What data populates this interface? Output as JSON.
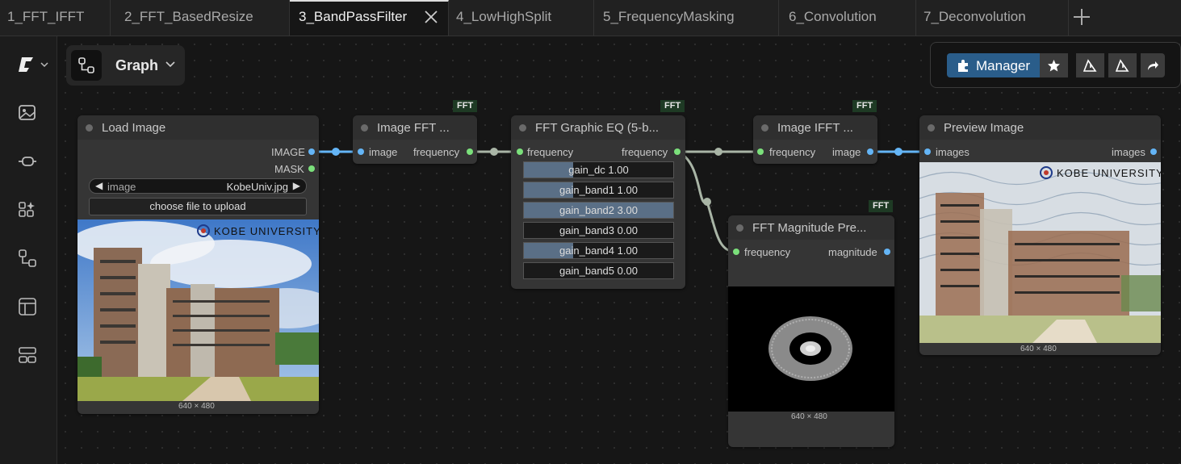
{
  "tabs": [
    {
      "label": "1_FFT_IFFT"
    },
    {
      "label": "2_FFT_BasedResize"
    },
    {
      "label": "3_BandPassFilter",
      "active": true
    },
    {
      "label": "4_LowHighSplit"
    },
    {
      "label": "5_FrequencyMasking"
    },
    {
      "label": "6_Convolution"
    },
    {
      "label": "7_Deconvolution"
    }
  ],
  "icons": {
    "logo": "comfy-logo-icon",
    "images": "images-icon",
    "nodes": "node-library-icon",
    "models": "model-library-icon",
    "workflows": "workflows-icon",
    "templates": "templates-icon",
    "queue": "queue-icon",
    "manager": "puzzle-icon",
    "star": "star-icon",
    "alert1": "warning-icon",
    "alert2": "warning-icon",
    "share": "share-icon"
  },
  "graph_button": {
    "label": "Graph"
  },
  "toolbar": {
    "manager_label": "Manager"
  },
  "nodes": {
    "load_image": {
      "title": "Load Image",
      "outputs": [
        "IMAGE",
        "MASK"
      ],
      "image_widget_label": "image",
      "image_widget_value": "KobeUniv.jpg",
      "upload_label": "choose file to upload",
      "size_caption": "640 × 480",
      "logo_text": "KOBE UNIVERSITY"
    },
    "image_fft": {
      "badge": "FFT",
      "title": "Image FFT ...",
      "input": "image",
      "output": "frequency"
    },
    "graphic_eq": {
      "badge": "FFT",
      "title": "FFT Graphic EQ (5-b...",
      "input": "frequency",
      "output": "frequency",
      "sliders": [
        {
          "label": "gain_dc",
          "value": "1.00",
          "fill": 0.33
        },
        {
          "label": "gain_band1",
          "value": "1.00",
          "fill": 0.33
        },
        {
          "label": "gain_band2",
          "value": "3.00",
          "fill": 1.0
        },
        {
          "label": "gain_band3",
          "value": "0.00",
          "fill": 0.0
        },
        {
          "label": "gain_band4",
          "value": "1.00",
          "fill": 0.33
        },
        {
          "label": "gain_band5",
          "value": "0.00",
          "fill": 0.0
        }
      ]
    },
    "image_ifft": {
      "badge": "FFT",
      "title": "Image IFFT ...",
      "input": "frequency",
      "output": "image"
    },
    "magnitude": {
      "badge": "FFT",
      "title": "FFT Magnitude Pre...",
      "input": "frequency",
      "output": "magnitude",
      "size_caption": "640 × 480"
    },
    "preview": {
      "title": "Preview Image",
      "input": "images",
      "output": "images",
      "size_caption": "640 × 480",
      "logo_text": "KOBE UNIVERSITY"
    }
  }
}
